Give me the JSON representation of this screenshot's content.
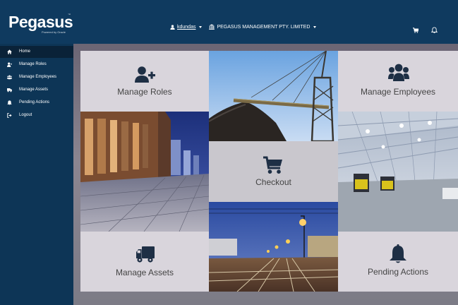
{
  "brand": {
    "name": "Pegasus",
    "tagline": "Powered by Oracle",
    "trademark": "™"
  },
  "header": {
    "username": "kdundas",
    "company": "PEGASUS MANAGEMENT PTY. LIMITED",
    "icons": [
      "user-icon",
      "bank-icon",
      "cart-icon",
      "bell-icon"
    ]
  },
  "sidebar": {
    "items": [
      {
        "label": "Home",
        "icon": "home-icon",
        "active": true
      },
      {
        "label": "Manage Roles",
        "icon": "user-plus-icon"
      },
      {
        "label": "Manage Employees",
        "icon": "users-icon"
      },
      {
        "label": "Manage Assets",
        "icon": "truck-icon"
      },
      {
        "label": "Pending Actions",
        "icon": "bell-icon"
      },
      {
        "label": "Logout",
        "icon": "sign-out-icon"
      }
    ]
  },
  "tiles": {
    "manage_roles": "Manage Roles",
    "manage_employees": "Manage Employees",
    "checkout": "Checkout",
    "manage_assets": "Manage Assets",
    "pending_actions": "Pending Actions"
  },
  "colors": {
    "header_bg": "#0f3a5f",
    "sidebar_bg": "#0d3556",
    "sidebar_active": "#0a2238",
    "tile_bg": "#d9d5dc",
    "tile_text": "#444444",
    "icon_dark": "#1e2f45"
  }
}
